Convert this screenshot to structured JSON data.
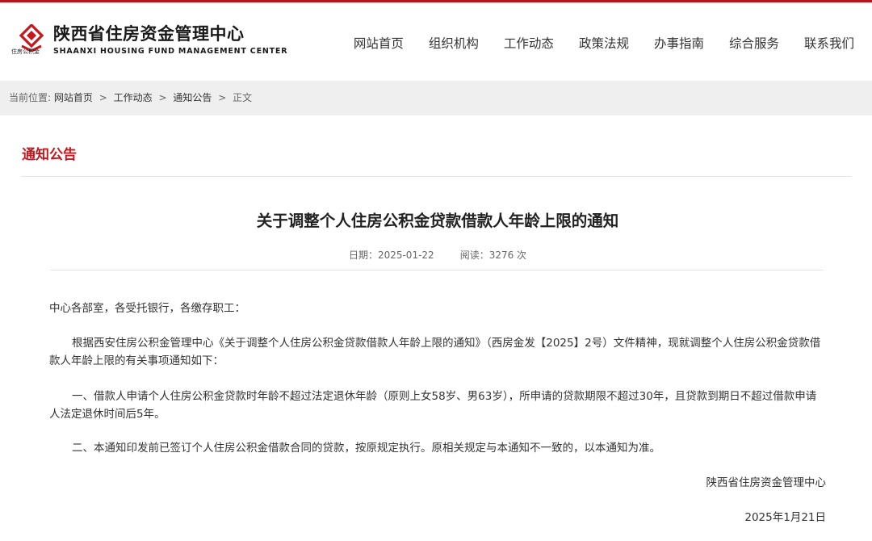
{
  "colors": {
    "brand_red": "#c8161d",
    "top_bar": "#b8121b",
    "crumb_bg": "#efefef",
    "rule": "#e4e4e4"
  },
  "logo": {
    "icon": "diamond-logo-icon",
    "mark_text": "住房公积金",
    "name_cn": "陕西省住房资金管理中心",
    "name_en": "SHAANXI HOUSING FUND MANAGEMENT CENTER"
  },
  "nav": {
    "items": [
      "网站首页",
      "组织机构",
      "工作动态",
      "政策法规",
      "办事指南",
      "综合服务",
      "联系我们"
    ]
  },
  "breadcrumb": {
    "label": "当前位置:",
    "links": [
      "网站首页",
      "工作动态",
      "通知公告"
    ],
    "separator": ">",
    "current": "正文"
  },
  "section": {
    "title": "通知公告"
  },
  "article": {
    "title": "关于调整个人住房公积金贷款借款人年龄上限的通知",
    "date_label": "日期：2025-01-22",
    "views_label": "阅读：3276 次",
    "salutation": "中心各部室，各受托银行，各缴存职工：",
    "paragraphs": [
      "根据西安住房公积金管理中心《关于调整个人住房公积金贷款借款人年龄上限的通知》（西房金发【2025】2号）文件精神，现就调整个人住房公积金贷款借款人年龄上限的有关事项通知如下：",
      "一、借款人申请个人住房公积金贷款时年龄不超过法定退休年龄（原则上女58岁、男63岁），所申请的贷款期限不超过30年，且贷款到期日不超过借款申请人法定退休时间后5年。",
      "二、本通知印发前已签订个人住房公积金借款合同的贷款，按原规定执行。原相关规定与本通知不一致的，以本通知为准。"
    ],
    "signature": "陕西省住房资金管理中心",
    "sign_date": "2025年1月21日"
  }
}
